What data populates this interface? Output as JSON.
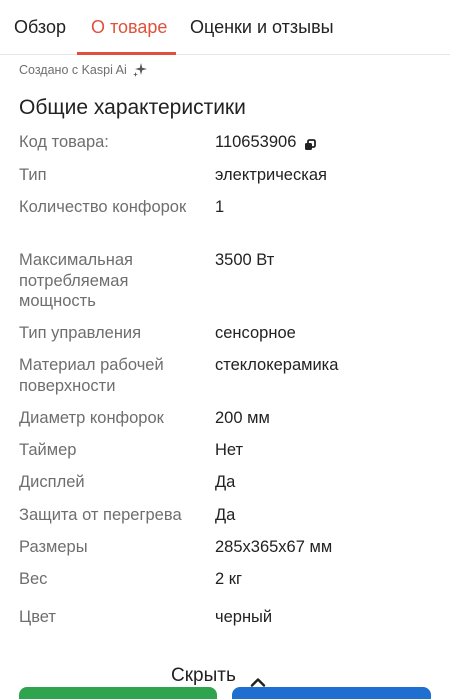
{
  "tabs": [
    {
      "label": "Обзор"
    },
    {
      "label": "О товаре"
    },
    {
      "label": "Оценки и отзывы"
    }
  ],
  "ai_note": "Создано с Kaspi Ai",
  "section_title": "Общие характеристики",
  "specs": [
    {
      "label": "Код товара:",
      "value": "110653906"
    },
    {
      "label": "Тип",
      "value": "электрическая"
    },
    {
      "label": "Количество конфорок",
      "value": "1"
    },
    {
      "label": "Максимальная потребляемая мощность",
      "value": "3500 Вт"
    },
    {
      "label": "Тип управления",
      "value": "сенсорное"
    },
    {
      "label": "Материал рабочей поверхности",
      "value": "стеклокерамика"
    },
    {
      "label": "Диаметр конфорок",
      "value": "200 мм"
    },
    {
      "label": "Таймер",
      "value": "Нет"
    },
    {
      "label": "Дисплей",
      "value": "Да"
    },
    {
      "label": "Защита от перегрева",
      "value": "Да"
    },
    {
      "label": "Размеры",
      "value": "285x365x67 мм"
    },
    {
      "label": "Вес",
      "value": "2 кг"
    },
    {
      "label": "Цвет",
      "value": "черный"
    }
  ],
  "collapse_label": "Скрыть",
  "colors": {
    "accent": "#e0503a",
    "green": "#2ea44f",
    "blue": "#1f6fd1"
  }
}
